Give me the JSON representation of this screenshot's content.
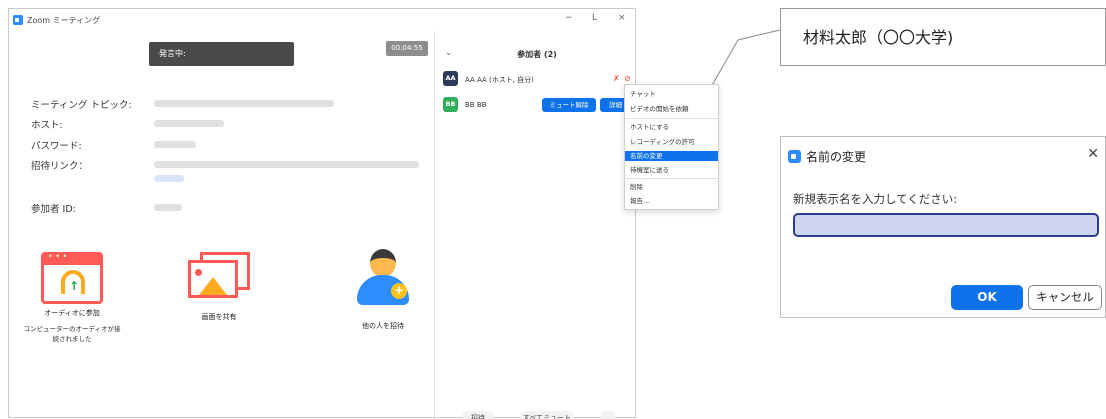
{
  "window": {
    "title": "Zoom ミーティング",
    "minimize": "−",
    "maximize": "L",
    "close": "×"
  },
  "meeting": {
    "status": "発言中:",
    "timer": "00:04:55",
    "labels": {
      "topic": "ミーティング トピック:",
      "host": "ホスト:",
      "password": "パスワード:",
      "invite_link": "招待リンク：",
      "participant_id": "参加者 ID:"
    }
  },
  "actions": {
    "audio": {
      "label": "オーディオに参加",
      "note_line1": "コンピューターのオーディオが接",
      "note_line2": "続されました"
    },
    "share": {
      "label": "画面を共有"
    },
    "invite": {
      "label": "他の人を招待"
    }
  },
  "participants": {
    "title": "参加者 (2)",
    "rows": [
      {
        "initials": "AA",
        "name": "AA AA (ホスト, 自分)",
        "color": "#2a3b58"
      },
      {
        "initials": "BB",
        "name": "BB BB",
        "color": "#2fae5b"
      }
    ],
    "unmute_label": "ミュート解除",
    "details_label": "詳細 ›",
    "footer": {
      "invite": "招待",
      "mute_all": "すべてミュート",
      "more": "..."
    }
  },
  "context_menu": {
    "items": [
      "チャット",
      "ビデオの開始を依頼",
      "ホストにする",
      "レコーディングの許可",
      "名前の変更",
      "待機室に送る",
      "削除",
      "報告..."
    ],
    "selected_index": 4
  },
  "callout": {
    "text": "材料太郎（〇〇大学)"
  },
  "rename_dialog": {
    "title": "名前の変更",
    "prompt": "新規表示名を入力してください:",
    "input_value": "",
    "ok_label": "OK",
    "cancel_label": "キャンセル"
  },
  "colors": {
    "accent": "#0e72ed",
    "zoom_blue": "#2d8cff",
    "selected_menu": "#0e72ed",
    "input_fill": "#cdd6ee"
  }
}
